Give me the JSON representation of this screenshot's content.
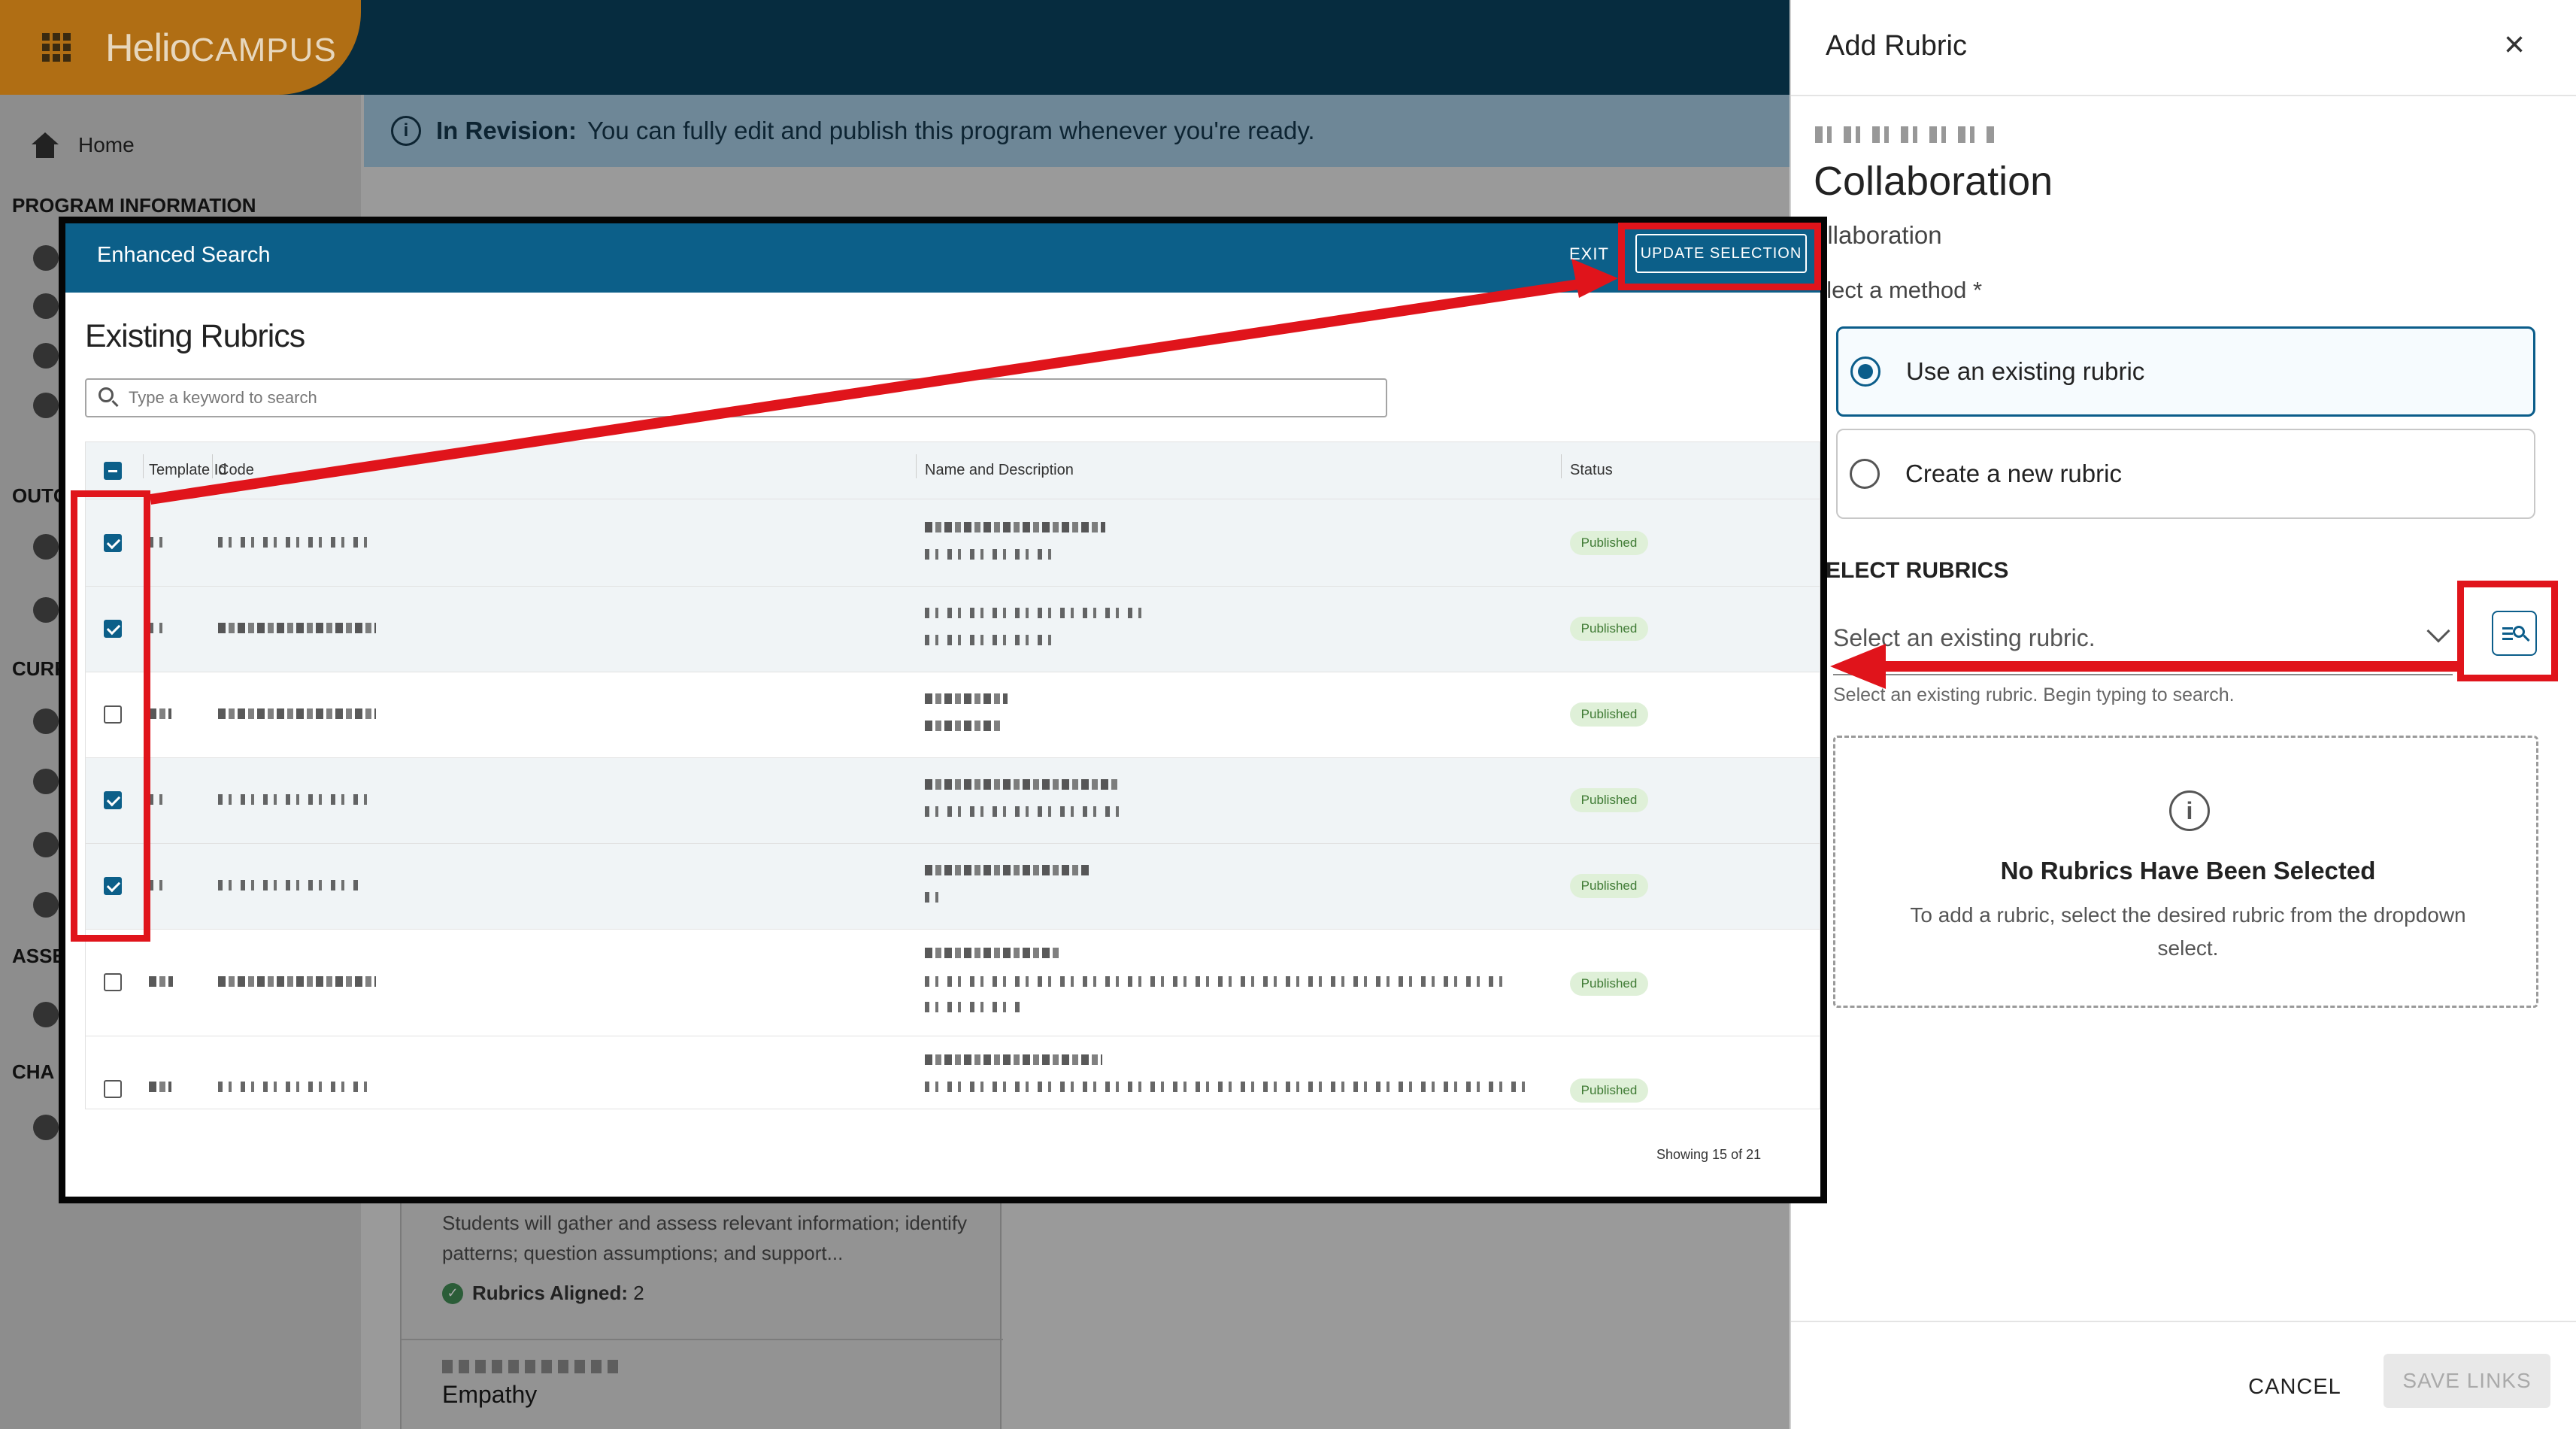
{
  "app": {
    "brand_primary": "Helio",
    "brand_secondary": "CAMPUS",
    "sidebar": {
      "home": "Home",
      "sections": [
        {
          "label": "PROGRAM INFORMATION"
        },
        {
          "label": "OUTC"
        },
        {
          "label": "CURR"
        },
        {
          "label": "ASSE"
        },
        {
          "label": "CHA"
        }
      ]
    },
    "banner": {
      "title": "In Revision:",
      "message": "You can fully edit and publish this program whenever you're ready.",
      "icon": "info-icon"
    },
    "background_card": {
      "description": "Students will gather and assess relevant information; identify patterns; question assumptions; and support...",
      "aligned_label": "Rubrics Aligned:",
      "aligned_count": "2",
      "next_title": "Empathy"
    }
  },
  "drawer": {
    "title": "Add Rubric",
    "close_icon": "close-icon",
    "outcome_title": "Collaboration",
    "outcome_sub": "ollaboration",
    "method_label": "elect a method *",
    "methods": [
      {
        "label": "Use an existing rubric",
        "selected": true
      },
      {
        "label": "Create a new rubric",
        "selected": false
      }
    ],
    "select_rubrics_label": "ELECT RUBRICS",
    "select_placeholder": "Select an existing rubric.",
    "select_helper": "Select an existing rubric. Begin typing to search.",
    "enhanced_search_icon": "enhanced-search-icon",
    "empty_title": "No Rubrics Have Been Selected",
    "empty_message": "To add a rubric, select the desired rubric from the dropdown select.",
    "cancel": "CANCEL",
    "save": "SAVE LINKS"
  },
  "modal": {
    "title": "Enhanced Search",
    "exit": "EXIT",
    "update": "UPDATE SELECTION",
    "heading": "Existing Rubrics",
    "search_placeholder": "Type a keyword to search",
    "columns": {
      "template_id": "Template Id",
      "code": "Code",
      "name": "Name and Description",
      "status": "Status"
    },
    "rows": [
      {
        "checked": true,
        "status": "Published"
      },
      {
        "checked": true,
        "status": "Published"
      },
      {
        "checked": false,
        "status": "Published"
      },
      {
        "checked": true,
        "status": "Published"
      },
      {
        "checked": true,
        "status": "Published"
      },
      {
        "checked": false,
        "status": "Published"
      },
      {
        "checked": false,
        "status": "Published"
      }
    ],
    "count": "Showing 15 of 21"
  },
  "colors": {
    "accent": "#0c5f89",
    "annotation_red": "#e0141b",
    "published_bg": "#dff0d8",
    "published_text": "#3e7a33"
  }
}
